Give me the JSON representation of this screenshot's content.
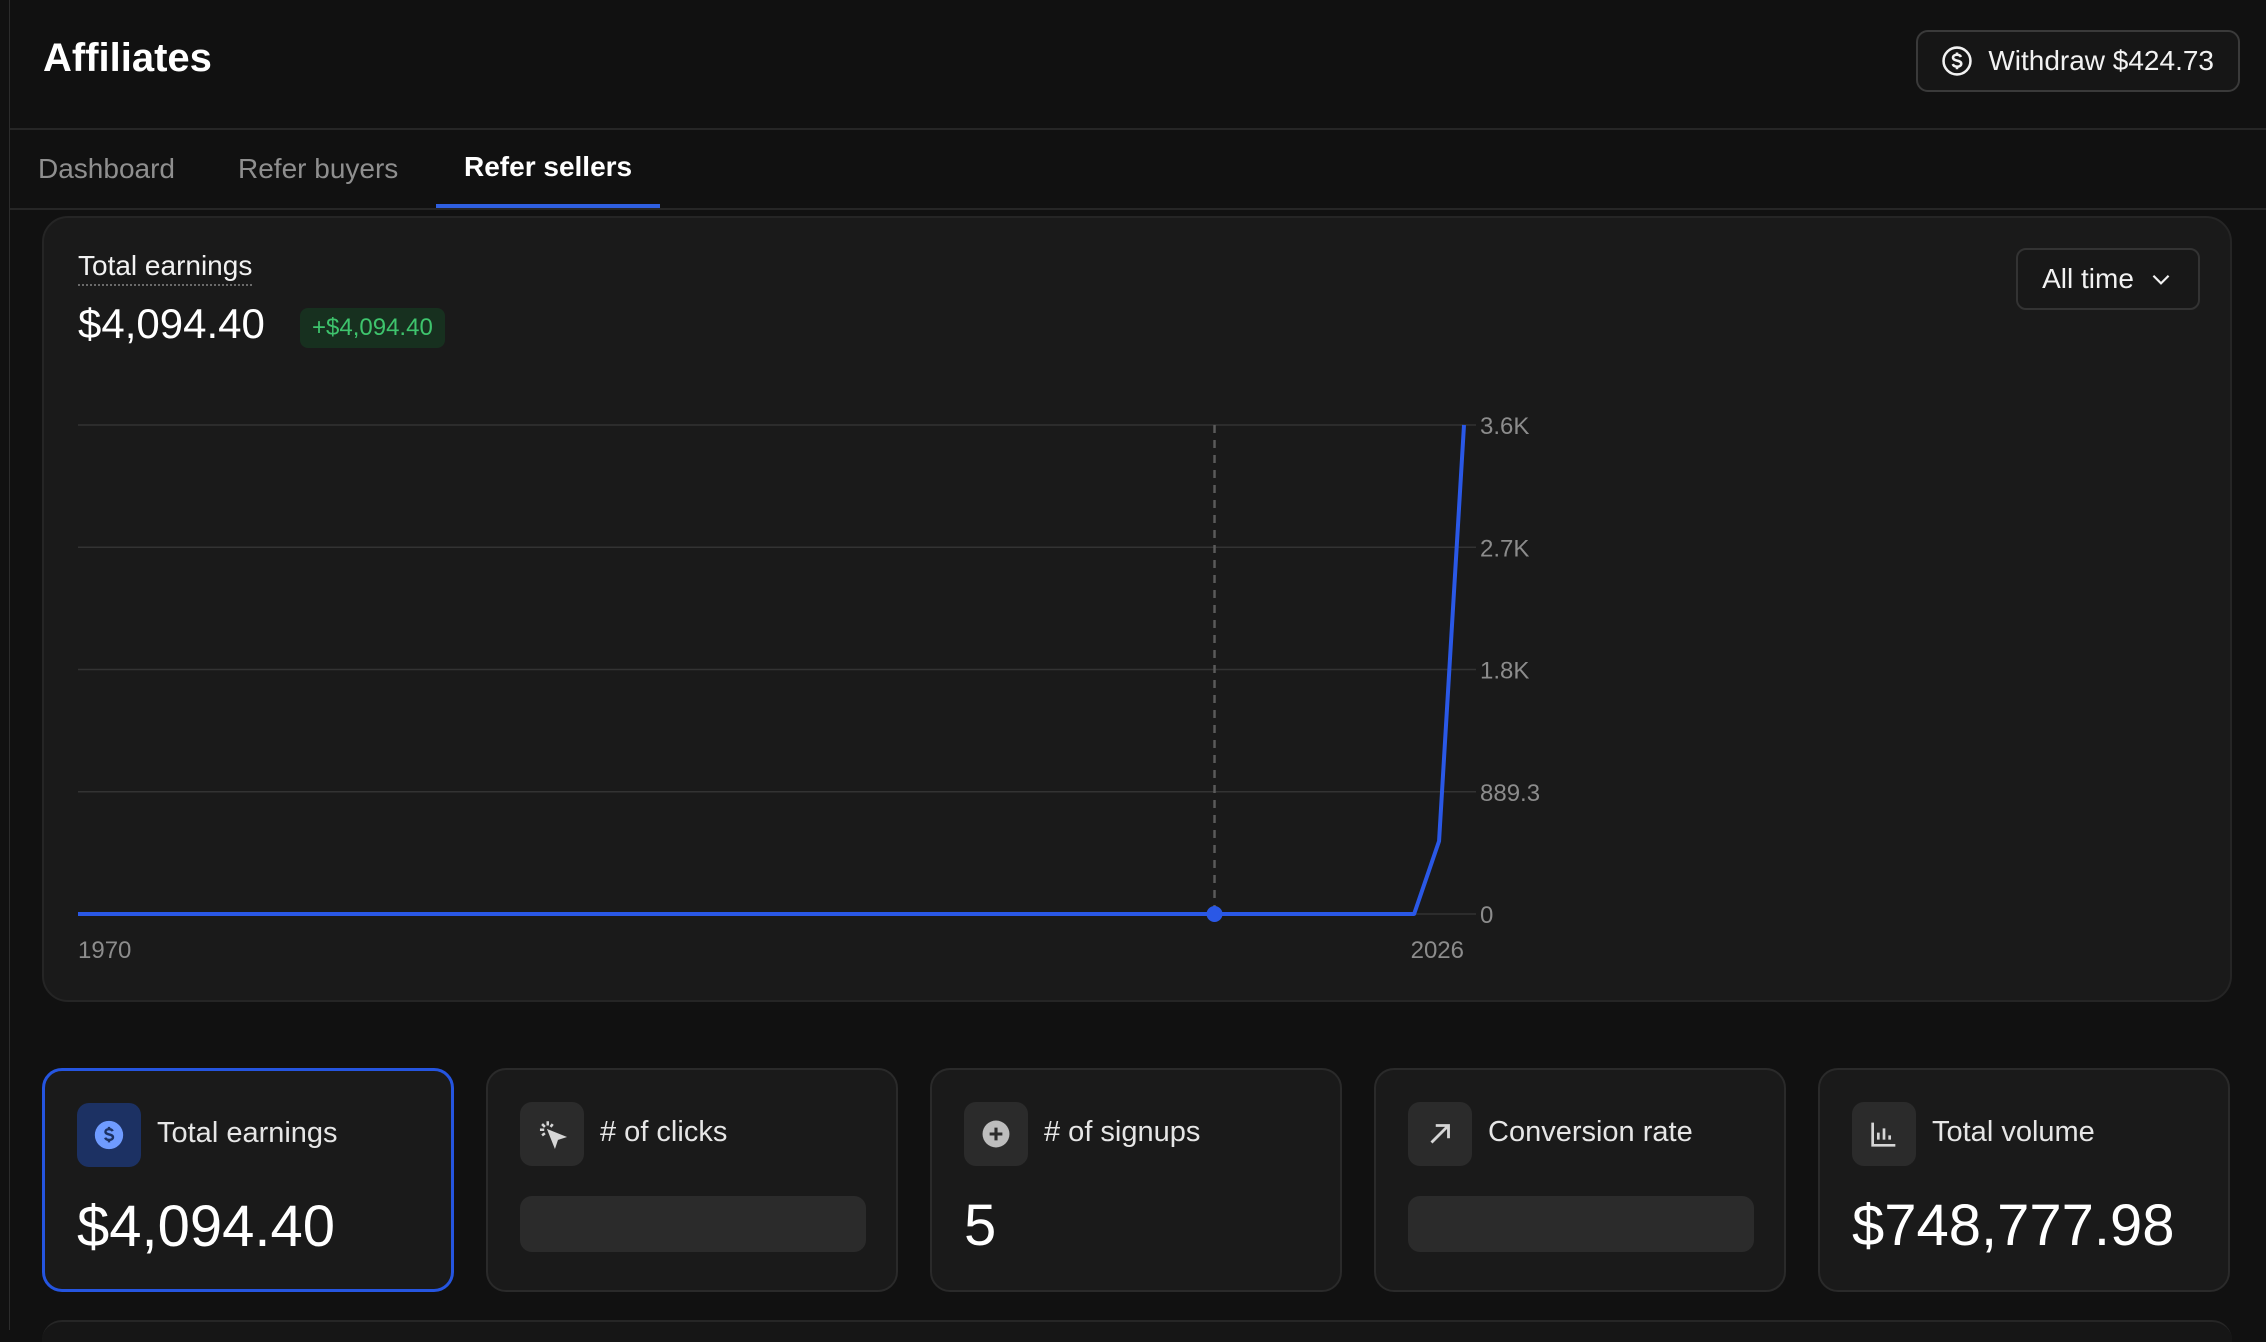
{
  "header": {
    "title": "Affiliates",
    "withdraw_label": "Withdraw $424.73"
  },
  "tabs": [
    {
      "label": "Dashboard",
      "active": false
    },
    {
      "label": "Refer buyers",
      "active": false
    },
    {
      "label": "Refer sellers",
      "active": true
    }
  ],
  "earnings_panel": {
    "label": "Total earnings",
    "total": "$4,094.40",
    "change": "+$4,094.40",
    "range": "All time"
  },
  "chart_data": {
    "type": "line",
    "x_tick_labels": [
      "1970",
      "2026"
    ],
    "y_ticks": [
      {
        "value": 0,
        "label": "0"
      },
      {
        "value": 889.3,
        "label": "889.3"
      },
      {
        "value": 1778.6,
        "label": "1.8K"
      },
      {
        "value": 2667.9,
        "label": "2.7K"
      },
      {
        "value": 3557.2,
        "label": "3.6K"
      }
    ],
    "ylim": [
      0,
      3557.2
    ],
    "series": [
      {
        "color": "#2a58e6",
        "x": [
          0,
          0.82,
          0.964,
          0.982,
          1.0
        ],
        "y": [
          0,
          0,
          0,
          530,
          3557.2
        ]
      }
    ],
    "hover_x": 0.82,
    "grid": true
  },
  "stats": [
    {
      "icon": "dollar-icon",
      "label": "Total earnings",
      "value": "$4,094.40",
      "loading": false,
      "selected": true
    },
    {
      "icon": "cursor-click-icon",
      "label": "# of clicks",
      "value": "",
      "loading": true,
      "selected": false
    },
    {
      "icon": "plus-circle-icon",
      "label": "# of signups",
      "value": "5",
      "loading": false,
      "selected": false
    },
    {
      "icon": "arrow-up-right-icon",
      "label": "Conversion rate",
      "value": "",
      "loading": true,
      "selected": false
    },
    {
      "icon": "bar-chart-icon",
      "label": "Total volume",
      "value": "$748,777.98",
      "loading": false,
      "selected": false
    }
  ],
  "colors": {
    "accent": "#2a58e6",
    "positive": "#3ec46d",
    "background": "#111111",
    "card": "#1a1a1a"
  }
}
